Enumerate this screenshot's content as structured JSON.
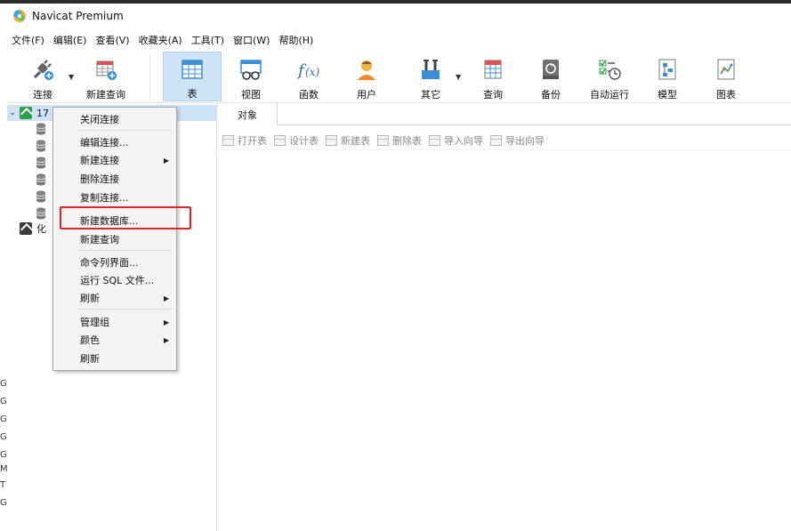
{
  "window": {
    "title": "Navicat Premium"
  },
  "menu": [
    "文件(F)",
    "编辑(E)",
    "查看(V)",
    "收藏夹(A)",
    "工具(T)",
    "窗口(W)",
    "帮助(H)"
  ],
  "toolbar": {
    "connect": "连接",
    "new_query": "新建查询",
    "table": "表",
    "view": "视图",
    "function": "函数",
    "user": "用户",
    "other": "其它",
    "query": "查询",
    "backup": "备份",
    "automation": "自动运行",
    "model": "模型",
    "chart": "图表"
  },
  "tree": {
    "connection1": "17",
    "connection2": "化"
  },
  "tabs": {
    "objects": "对象"
  },
  "object_toolbar": [
    "打开表",
    "设计表",
    "新建表",
    "删除表",
    "导入向导",
    "导出向导"
  ],
  "context_menu": {
    "close_connection": "关闭连接",
    "edit_connection": "编辑连接...",
    "new_connection": "新建连接",
    "delete_connection": "删除连接",
    "copy_connection": "复制连接...",
    "new_database": "新建数据库...",
    "new_query": "新建查询",
    "command_line": "命令列界面...",
    "run_sql": "运行 SQL 文件...",
    "refresh1": "刷新",
    "manage_group": "管理组",
    "color": "颜色",
    "refresh2": "刷新"
  },
  "left_edge_glyphs": [
    "G",
    "G",
    "G",
    "G",
    "G",
    "M",
    "T",
    "G"
  ],
  "colors": {
    "highlight_border": "#e0202a",
    "selection": "#cfe3f6",
    "accent": "#1f6fbf"
  }
}
